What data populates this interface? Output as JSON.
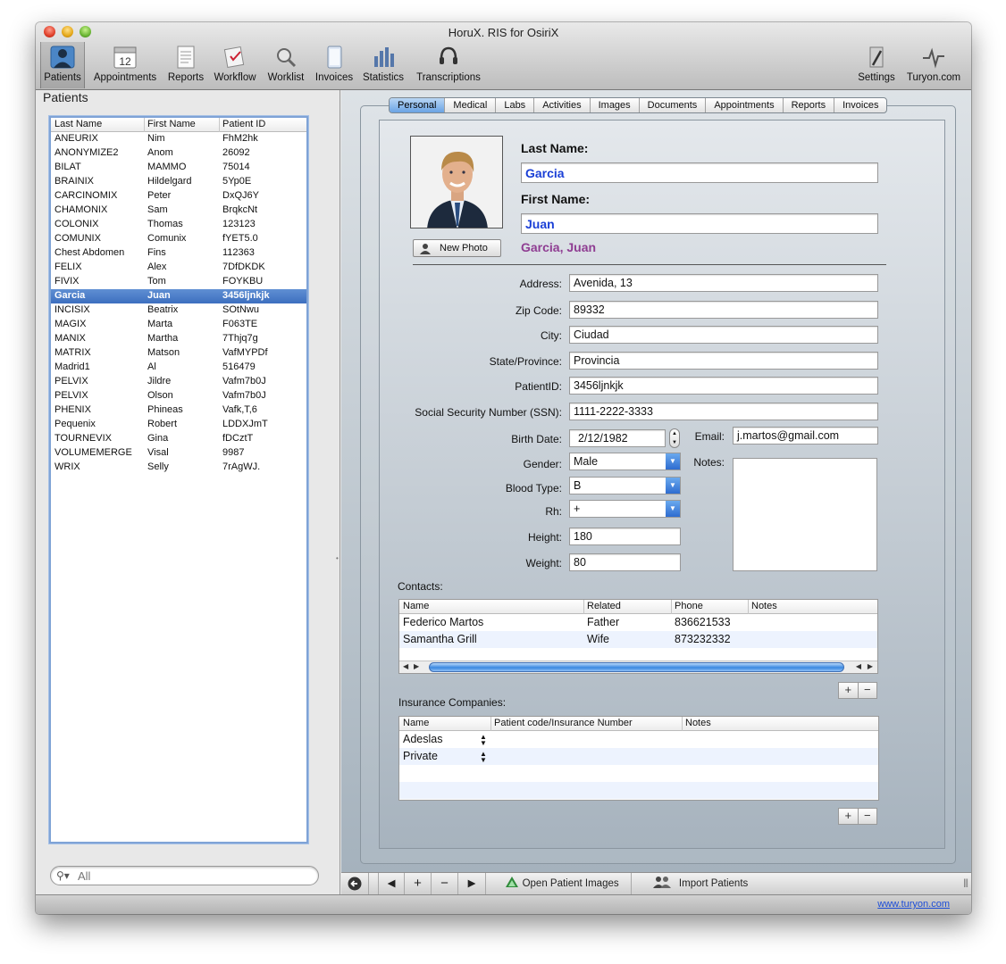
{
  "window": {
    "title": "HoruX. RIS for OsiriX"
  },
  "toolbar": {
    "items": [
      {
        "label": "Patients",
        "icon": "patients-icon"
      },
      {
        "label": "Appointments",
        "icon": "calendar-icon",
        "day": "12"
      },
      {
        "label": "Reports",
        "icon": "reports-icon"
      },
      {
        "label": "Workflow",
        "icon": "workflow-icon"
      },
      {
        "label": "Worklist",
        "icon": "worklist-icon"
      },
      {
        "label": "Invoices",
        "icon": "invoices-icon"
      },
      {
        "label": "Statistics",
        "icon": "statistics-icon"
      },
      {
        "label": "Transcriptions",
        "icon": "headset-icon"
      }
    ],
    "right_items": [
      {
        "label": "Settings",
        "icon": "settings-icon"
      },
      {
        "label": "Turyon.com",
        "icon": "turyon-icon"
      }
    ]
  },
  "patients_panel": {
    "title": "Patients",
    "columns": [
      "Last Name",
      "First Name",
      "Patient ID"
    ],
    "rows": [
      [
        "ANEURIX",
        "Nim",
        "FhM2hk"
      ],
      [
        "ANONYMIZE2",
        "Anom",
        "26092"
      ],
      [
        "BILAT",
        " MAMMO",
        "75014"
      ],
      [
        "BRAINIX",
        "Hildelgard",
        "5Yp0E"
      ],
      [
        "CARCINOMIX",
        "Peter",
        "DxQJ6Y"
      ],
      [
        "CHAMONIX",
        "Sam",
        "BrqkcNt"
      ],
      [
        "COLONIX",
        "Thomas",
        "123123"
      ],
      [
        "COMUNIX",
        "Comunix",
        "fYET5.0"
      ],
      [
        "Chest Abdomen",
        "Fins",
        "112363"
      ],
      [
        "FELIX",
        "Alex",
        "7DfDKDK"
      ],
      [
        "FIVIX",
        "Tom",
        "FOYKBU"
      ],
      [
        "Garcia",
        "Juan",
        "3456ljnkjk"
      ],
      [
        "INCISIX",
        "Beatrix",
        "SOtNwu"
      ],
      [
        "MAGIX",
        "Marta",
        "F063TE"
      ],
      [
        "MANIX",
        "Martha",
        "7Thjq7g"
      ],
      [
        "MATRIX",
        "Matson",
        "VafMYPDf"
      ],
      [
        "Madrid1",
        "Al",
        "516479"
      ],
      [
        "PELVIX",
        "Jildre",
        "Vafm7b0J"
      ],
      [
        "PELVIX",
        "Olson",
        "Vafm7b0J"
      ],
      [
        "PHENIX",
        "Phineas",
        "Vafk,T,6"
      ],
      [
        "Pequenix",
        "Robert",
        "LDDXJmT"
      ],
      [
        "TOURNEVIX",
        "Gina",
        "fDCztT"
      ],
      [
        "VOLUMEMERGE",
        "Visal",
        "9987"
      ],
      [
        "WRIX",
        "Selly",
        "7rAgWJ."
      ]
    ],
    "selected_index": 11,
    "search_placeholder": "All"
  },
  "tabs": [
    "Personal",
    "Medical",
    "Labs",
    "Activities",
    "Images",
    "Documents",
    "Appointments",
    "Reports",
    "Invoices"
  ],
  "active_tab": "Personal",
  "personal": {
    "last_name_label": "Last Name:",
    "last_name": "Garcia",
    "first_name_label": "First Name:",
    "first_name": "Juan",
    "full_name": "Garcia, Juan",
    "new_photo_label": "New Photo",
    "address_label": "Address:",
    "address": "Avenida, 13",
    "zip_label": "Zip Code:",
    "zip": "89332",
    "city_label": "City:",
    "city": "Ciudad",
    "state_label": "State/Province:",
    "state": "Provincia",
    "patient_id_label": "PatientID:",
    "patient_id": "3456ljnkjk",
    "ssn_label": "Social Security Number (SSN):",
    "ssn": "1111-2222-3333",
    "birth_label": "Birth Date:",
    "birth": "2/12/1982",
    "email_label": "Email:",
    "email": "j.martos@gmail.com",
    "gender_label": "Gender:",
    "gender": "Male",
    "notes_label": "Notes:",
    "blood_label": "Blood Type:",
    "blood": "B",
    "rh_label": "Rh:",
    "rh": "+",
    "height_label": "Height:",
    "height": "180",
    "weight_label": "Weight:",
    "weight": "80"
  },
  "contacts": {
    "label": "Contacts:",
    "columns": [
      "Name",
      "Related",
      "Phone",
      "Notes"
    ],
    "rows": [
      [
        "Federico Martos",
        "Father",
        "836621533",
        ""
      ],
      [
        "Samantha Grill",
        "Wife",
        "873232332",
        ""
      ]
    ]
  },
  "insurance": {
    "label": "Insurance Companies:",
    "columns": [
      "Name",
      "Patient code/Insurance Number",
      "Notes"
    ],
    "rows": [
      [
        "Adeslas",
        "",
        ""
      ],
      [
        "Private",
        "",
        ""
      ]
    ]
  },
  "bottom_bar": {
    "open_images_label": "Open Patient Images",
    "import_label": "Import Patients"
  },
  "status": {
    "link": "www.turyon.com"
  },
  "colors": {
    "selection": "#3d6fbf",
    "field_text_blue": "#1a3fd6",
    "full_name_purple": "#8f3d92",
    "link": "#1d4ed8"
  }
}
